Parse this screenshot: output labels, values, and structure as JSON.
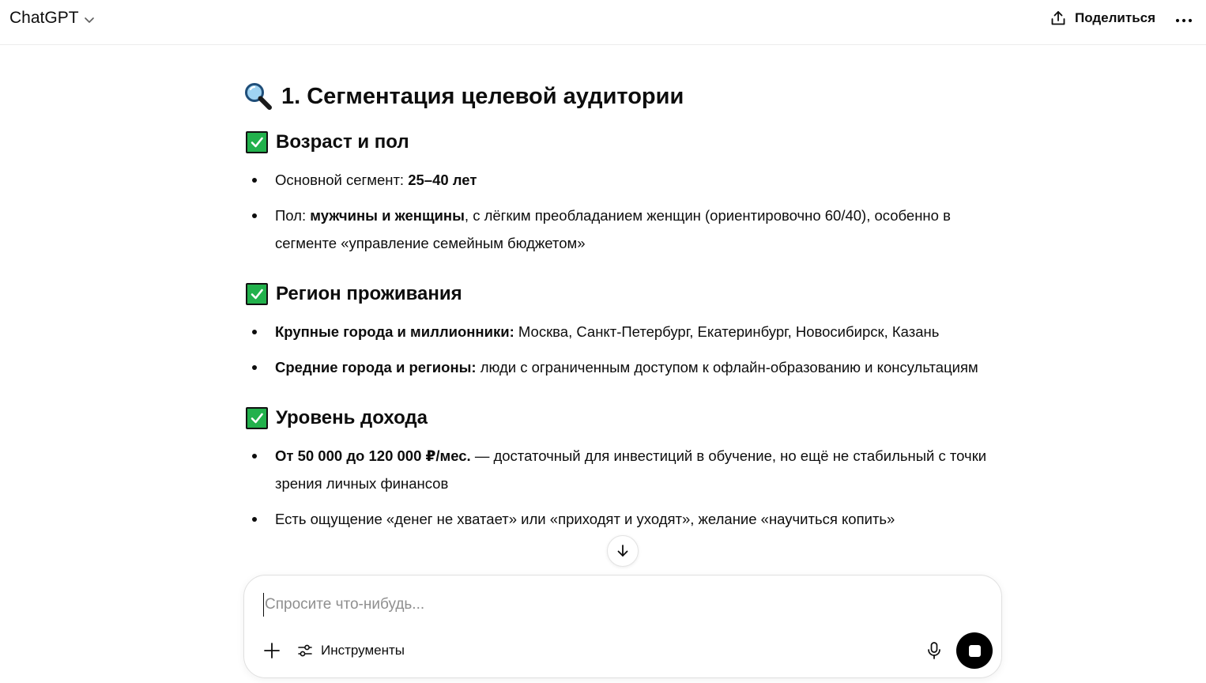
{
  "header": {
    "model_label": "ChatGPT",
    "share_label": "Поделиться"
  },
  "message": {
    "title_emoji": "magnifier-icon",
    "title": "1. Сегментация целевой аудитории",
    "sections": [
      {
        "heading": "Возраст и пол",
        "items": [
          {
            "bold": "",
            "plain": "Основной сегмент: ",
            "bold2": "25–40 лет",
            "tail": ""
          },
          {
            "plain": "Пол: ",
            "bold2": "мужчины и женщины",
            "tail": ", с лёгким преобладанием женщин (ориентировочно 60/40), особенно в сегменте «управление семейным бюджетом»"
          }
        ]
      },
      {
        "heading": "Регион проживания",
        "items": [
          {
            "bold": "Крупные города и миллионники:",
            "tail": " Москва, Санкт-Петербург, Екатеринбург, Новосибирск, Казань"
          },
          {
            "bold": "Средние города и регионы:",
            "tail": " люди с ограниченным доступом к офлайн-образованию и консультациям"
          }
        ]
      },
      {
        "heading": "Уровень дохода",
        "items": [
          {
            "bold": "От 50 000 до 120 000 ₽/мес.",
            "tail": " — достаточный для инвестиций в обучение, но ещё не стабильный с точки зрения личных финансов"
          },
          {
            "bold": "",
            "tail": "Есть ощущение «денег не хватает» или «приходят и уходят», желание «научиться копить»"
          }
        ]
      }
    ]
  },
  "composer": {
    "placeholder": "Спросите что-нибудь...",
    "tools_label": "Инструменты"
  },
  "colors": {
    "check_green": "#22b14c",
    "text": "#0d0d0d",
    "stop_button": "#000000"
  }
}
